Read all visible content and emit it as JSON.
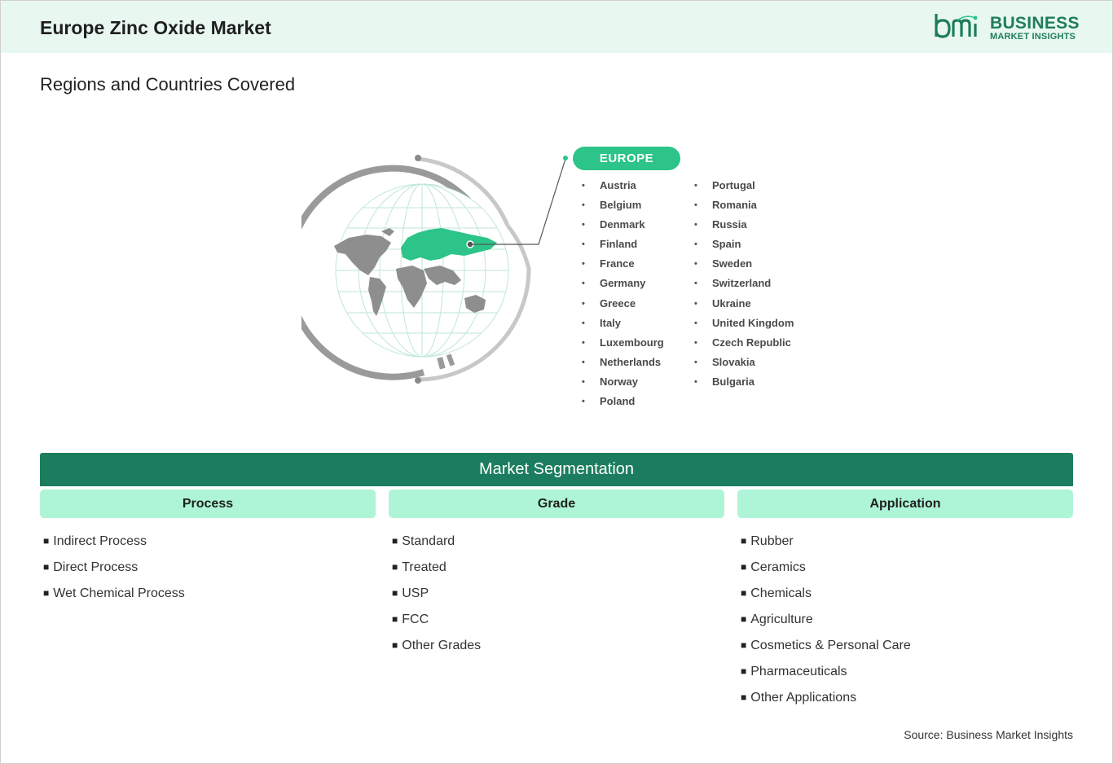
{
  "header": {
    "title": "Europe Zinc Oxide Market"
  },
  "logo": {
    "line1": "BUSINESS",
    "line2": "MARKET INSIGHTS",
    "mark": "bmi"
  },
  "subtitle": "Regions and Countries Covered",
  "region": {
    "name": "EUROPE",
    "countries_col1": [
      "Austria",
      "Belgium",
      "Denmark",
      "Finland",
      "France",
      "Germany",
      "Greece",
      "Italy",
      "Luxembourg",
      "Netherlands",
      "Norway",
      "Poland"
    ],
    "countries_col2": [
      "Portugal",
      "Romania",
      "Russia",
      "Spain",
      "Sweden",
      "Switzerland",
      "Ukraine",
      "United Kingdom",
      "Czech Republic",
      "Slovakia",
      "Bulgaria"
    ]
  },
  "segmentation": {
    "title": "Market Segmentation",
    "columns": [
      {
        "heading": "Process",
        "items": [
          "Indirect Process",
          "Direct Process",
          "Wet Chemical Process"
        ]
      },
      {
        "heading": "Grade",
        "items": [
          "Standard",
          "Treated",
          "USP",
          "FCC",
          "Other Grades"
        ]
      },
      {
        "heading": "Application",
        "items": [
          "Rubber",
          "Ceramics",
          "Chemicals",
          "Agriculture",
          "Cosmetics & Personal Care",
          "Pharmaceuticals",
          "Other Applications"
        ]
      }
    ]
  },
  "source": "Source: Business Market Insights",
  "colors": {
    "brand": "#1e7d5b",
    "accent": "#2cc488",
    "header_bg": "#e8f8f1",
    "segment_head_bg": "#adf5d6"
  }
}
